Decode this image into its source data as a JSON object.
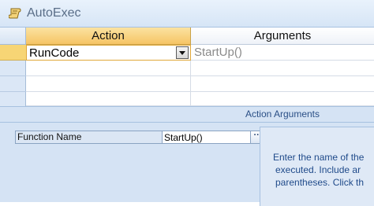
{
  "window": {
    "title": "AutoExec",
    "icon": "macro-scroll-icon"
  },
  "grid": {
    "headers": {
      "action": "Action",
      "arguments": "Arguments"
    },
    "rows": [
      {
        "action": "RunCode",
        "arguments": "StartUp()"
      },
      {
        "action": "",
        "arguments": ""
      },
      {
        "action": "",
        "arguments": ""
      },
      {
        "action": "",
        "arguments": ""
      }
    ]
  },
  "action_arguments": {
    "title": "Action Arguments",
    "function_name_label": "Function Name",
    "function_name_value": "StartUp()",
    "build_button_label": "···",
    "help_line1": "Enter the name of the",
    "help_line2": "executed. Include ar",
    "help_line3": "parentheses. Click th"
  },
  "colors": {
    "active_header": "#f6c465",
    "panel_background": "#d5e3f4",
    "help_text": "#1f4a8a"
  }
}
